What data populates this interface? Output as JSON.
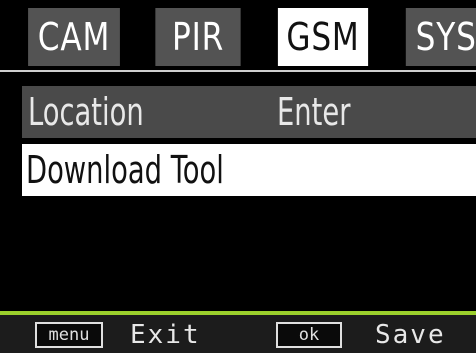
{
  "tabs": [
    {
      "label": "CAM",
      "active": false
    },
    {
      "label": "PIR",
      "active": false
    },
    {
      "label": "GSM",
      "active": true
    },
    {
      "label": "SYS",
      "active": false
    }
  ],
  "menu": {
    "items": [
      {
        "label": "Location",
        "value": "Enter",
        "selected": false
      },
      {
        "label": "Download Tool",
        "value": "",
        "selected": true
      }
    ]
  },
  "footer": {
    "menu_key": "menu",
    "menu_action": "Exit",
    "ok_key": "ok",
    "ok_action": "Save"
  },
  "colors": {
    "tab_inactive": "#535353",
    "tab_active": "#ffffff",
    "row_normal": "#4a4a4a",
    "row_selected": "#ffffff",
    "footer_accent": "#9bcf2c"
  }
}
